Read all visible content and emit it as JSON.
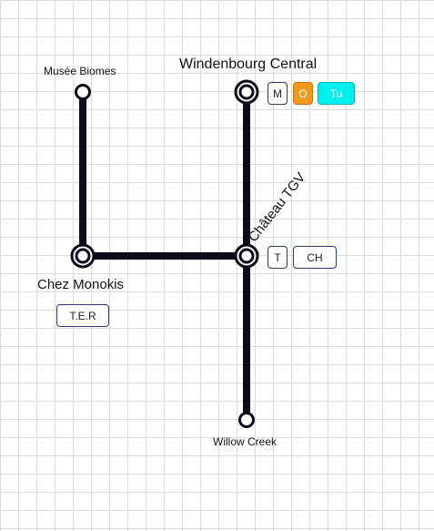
{
  "stations": {
    "musee_biomes": "Musée Biomes",
    "windenbourg_central": "Windenbourg Central",
    "chez_monokis": "Chez Monokis",
    "chateau_tgv": "Château TGV",
    "willow_creek": "Willow Creek"
  },
  "lines": {
    "windenbourg": [
      "M",
      "O",
      "Tu"
    ],
    "chateau": [
      "T",
      "CH"
    ],
    "chez_monokis": [
      "T.E.R"
    ]
  },
  "colors": {
    "track": "#0b0b1a",
    "line_o": "#f39a1e",
    "line_tu": "#00f0f0",
    "chip_border": "#2b3a67"
  }
}
